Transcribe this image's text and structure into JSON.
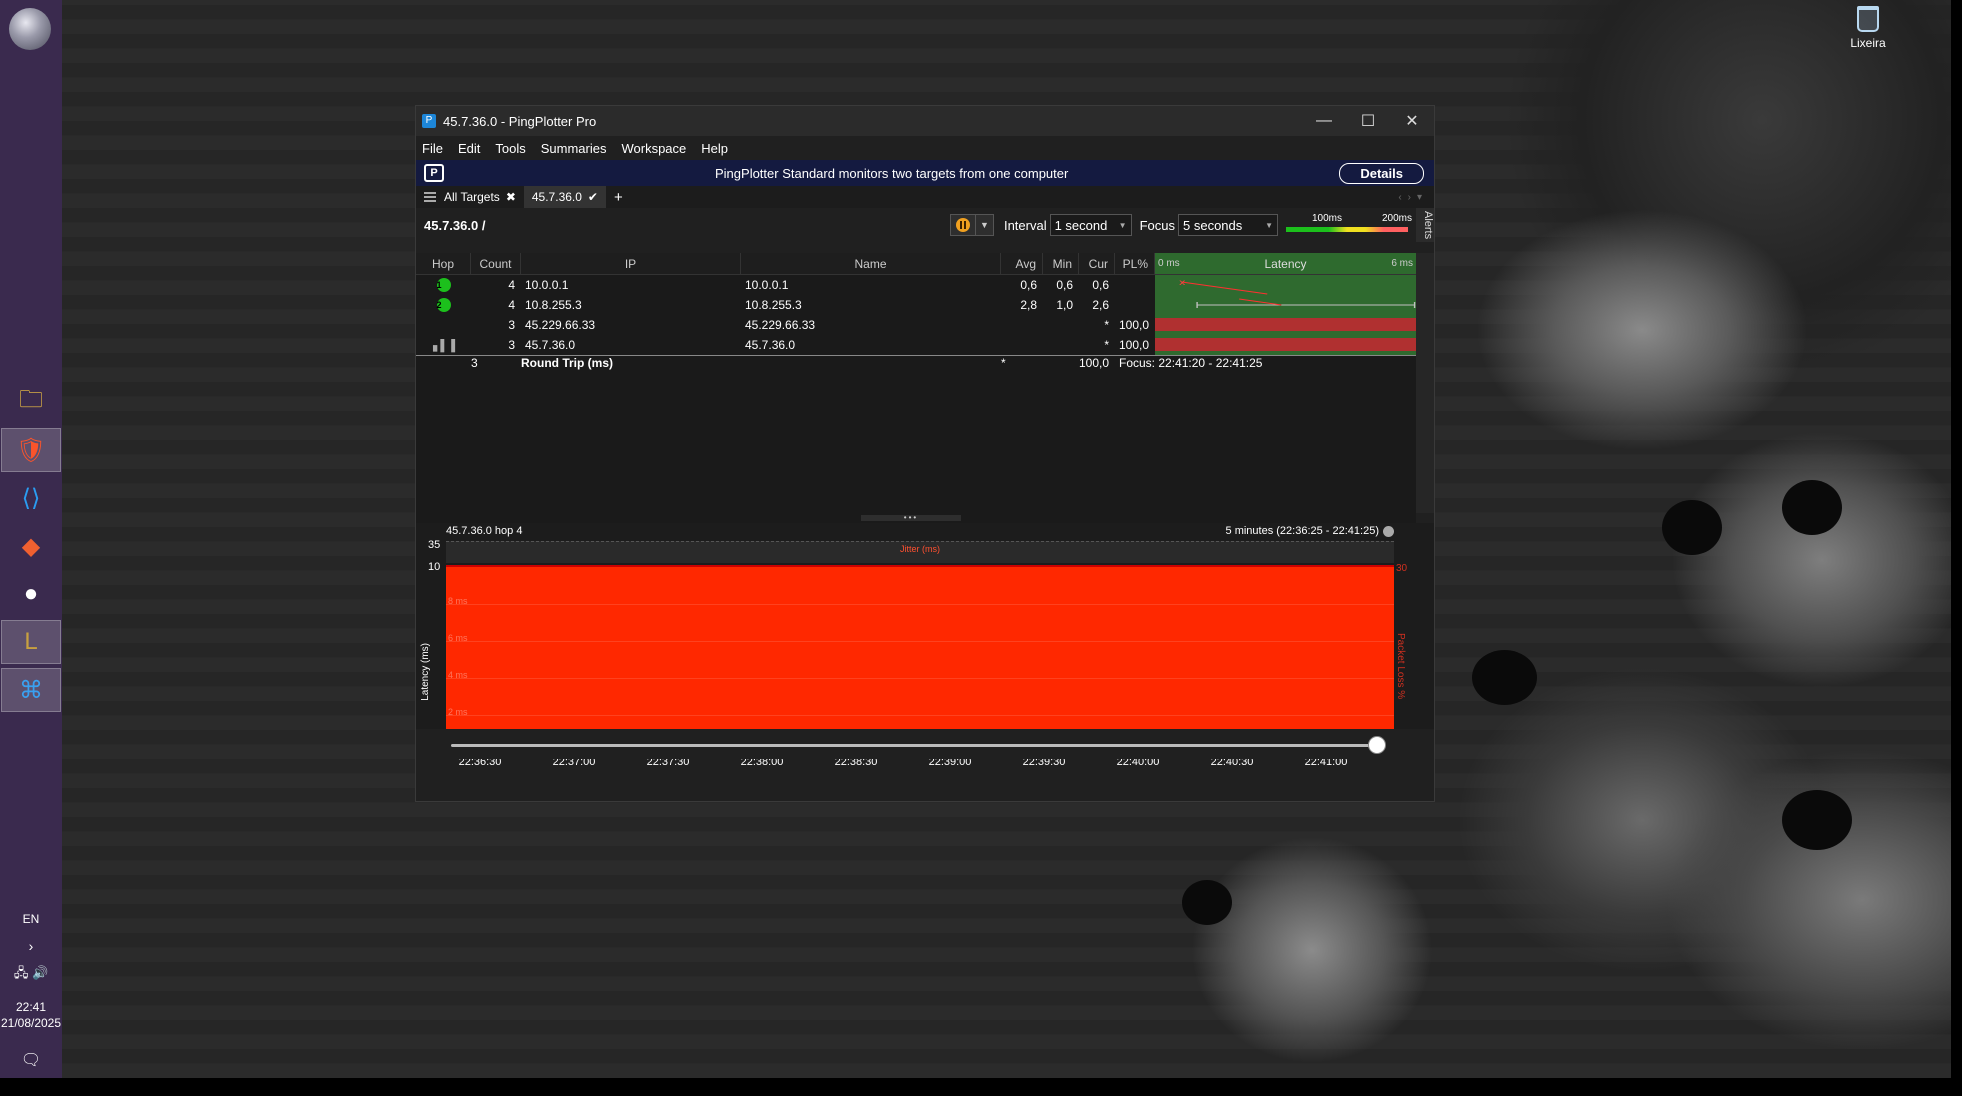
{
  "window": {
    "title": "45.7.36.0 - PingPlotter Pro",
    "controls": {
      "minimize": "—",
      "maximize": "☐",
      "close": "✕"
    }
  },
  "menu": [
    "File",
    "Edit",
    "Tools",
    "Summaries",
    "Workspace",
    "Help"
  ],
  "banner": {
    "message": "PingPlotter Standard monitors two targets from one computer",
    "details_label": "Details"
  },
  "tabs": {
    "all_targets": "All Targets",
    "current": "45.7.36.0",
    "add": "+"
  },
  "toolbar": {
    "target_path": "45.7.36.0 /",
    "interval_label": "Interval",
    "interval_value": "1 second",
    "focus_label": "Focus",
    "focus_value": "5 seconds",
    "scale_100": "100ms",
    "scale_200": "200ms",
    "alerts": "Alerts"
  },
  "table": {
    "headers": {
      "hop": "Hop",
      "count": "Count",
      "ip": "IP",
      "name": "Name",
      "avg": "Avg",
      "min": "Min",
      "cur": "Cur",
      "pl": "PL%",
      "lat_min": "0 ms",
      "latency": "Latency",
      "lat_max": "6 ms"
    },
    "rows": [
      {
        "hop": "1",
        "count": "4",
        "ip": "10.0.0.1",
        "name": "10.0.0.1",
        "avg": "0,6",
        "min": "0,6",
        "cur": "0,6",
        "pl": ""
      },
      {
        "hop": "2",
        "count": "4",
        "ip": "10.8.255.3",
        "name": "10.8.255.3",
        "avg": "2,8",
        "min": "1,0",
        "cur": "2,6",
        "pl": ""
      },
      {
        "hop": "",
        "count": "3",
        "ip": "45.229.66.33",
        "name": "45.229.66.33",
        "avg": "",
        "min": "",
        "cur": "*",
        "pl": "100,0"
      },
      {
        "hop": "",
        "count": "3",
        "ip": "45.7.36.0",
        "name": "45.7.36.0",
        "avg": "",
        "min": "",
        "cur": "*",
        "pl": "100,0"
      }
    ],
    "round_trip": {
      "count": "3",
      "label": "Round Trip (ms)",
      "cur": "*",
      "pl": "100,0",
      "focus": "Focus: 22:41:20 - 22:41:25"
    }
  },
  "graph": {
    "title": "45.7.36.0 hop 4",
    "range": "5 minutes (22:36:25 - 22:41:25)",
    "jitter_label": "Jitter (ms)",
    "y_top_jitter": "35",
    "y_top": "10",
    "y_bottom": "0",
    "y_right_top": "30",
    "y_title": "Latency (ms)",
    "y_right_title": "Packet Loss %",
    "gridlines": [
      "8 ms",
      "6 ms",
      "4 ms",
      "2 ms"
    ],
    "x_ticks": [
      "22:36:30",
      "22:37:00",
      "22:37:30",
      "22:38:00",
      "22:38:30",
      "22:39:00",
      "22:39:30",
      "22:40:00",
      "22:40:30",
      "22:41:00"
    ]
  },
  "desktop": {
    "recycle_bin": "Lixeira",
    "lang": "EN",
    "time": "22:41",
    "date": "21/08/2025"
  },
  "colors": {
    "loss": "#ff2800",
    "ok": "#1cc01c",
    "banner": "#141a40",
    "taskbar": "#3a2a4e"
  }
}
